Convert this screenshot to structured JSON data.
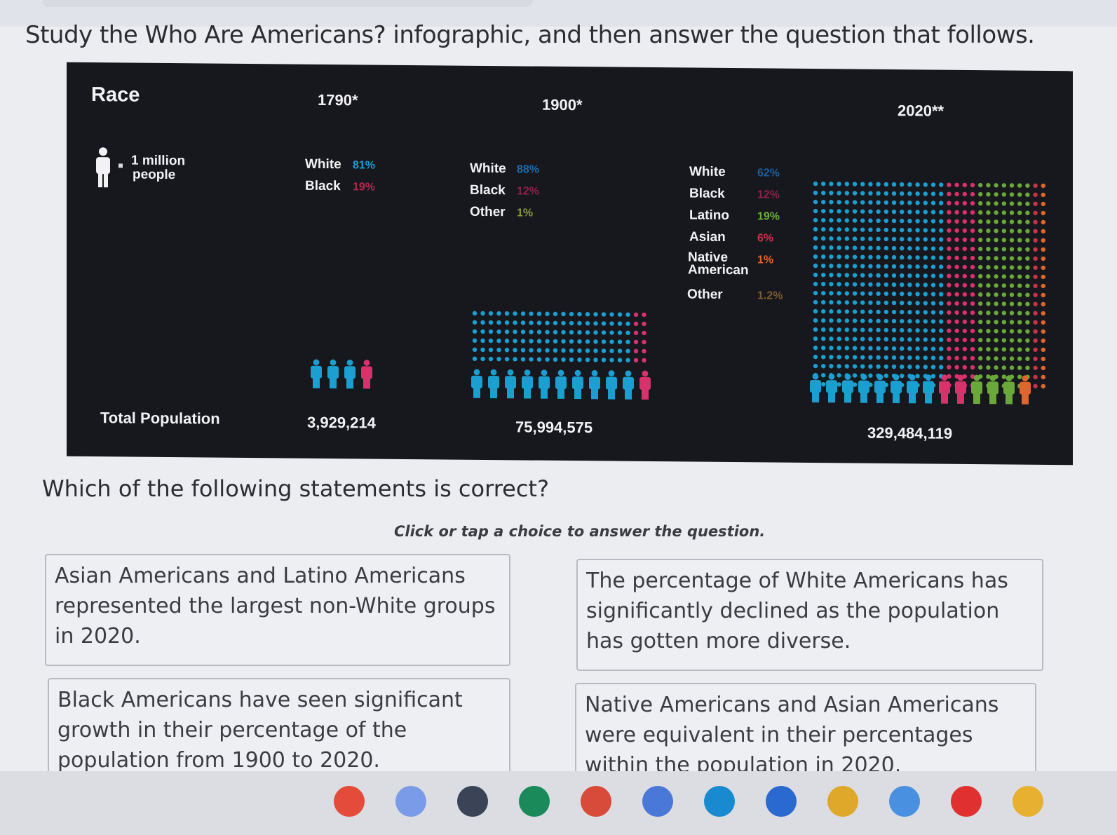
{
  "prompt": "Study the Who Are Americans? infographic, and then answer the question that follows.",
  "infographic": {
    "race_title": "Race",
    "legend_text_line1": "1 million",
    "legend_text_line2": "people",
    "years": [
      "1790*",
      "1900*",
      "2020**"
    ],
    "y1790": {
      "labels": [
        "White",
        "Black"
      ],
      "percents": [
        "81%",
        "19%"
      ]
    },
    "y1900": {
      "labels": [
        "White",
        "Black",
        "Other"
      ],
      "percents": [
        "88%",
        "12%",
        "1%"
      ]
    },
    "y2020": {
      "labels": [
        "White",
        "Black",
        "Latino",
        "Asian",
        "Native",
        "American",
        "Other"
      ],
      "percents": [
        "62%",
        "12%",
        "19%",
        "6%",
        "1%",
        "1.2%"
      ]
    },
    "total_label": "Total Population",
    "totals": [
      "3,929,214",
      "75,994,575",
      "329,484,119"
    ],
    "colors": {
      "white": "#1a9fd0",
      "black": "#d8326a",
      "other": "#7a8a2a",
      "latino": "#6aa83a",
      "asian": "#c8324a",
      "native": "#e0662e",
      "other2020": "#8a6a3a",
      "background": "#17181d"
    }
  },
  "question": "Which of the following statements is correct?",
  "instruction": "Click or tap a choice to answer the question.",
  "choices": {
    "a": "Asian Americans and Latino Americans represented the largest non-White groups in 2020.",
    "b": "The percentage of White Americans has significantly declined as the population has gotten more diverse.",
    "c": "Black Americans have seen significant growth in their percentage of the population from 1900 to 2020.",
    "d": "Native Americans and Asian Americans were equivalent in their percentages within the population in 2020."
  },
  "shelf_icons": [
    "chrome-icon",
    "gemini-icon",
    "fingerprint-app-icon",
    "classroom-app-icon",
    "gmail-icon",
    "calendar-icon",
    "files-icon",
    "messages-icon",
    "meet-icon",
    "play-store-icon",
    "youtube-icon",
    "photos-icon"
  ]
}
